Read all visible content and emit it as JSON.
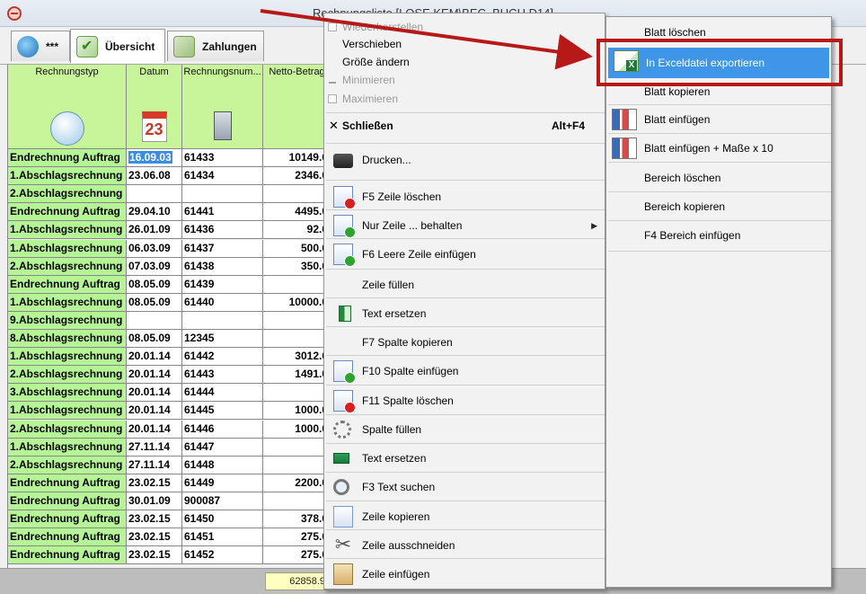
{
  "window": {
    "title": "Rechnungsliste [LOSE KEM\\BEC_BUCH D14]"
  },
  "tabs": [
    {
      "label": "***",
      "icon": "globe-icon"
    },
    {
      "label": "Übersicht",
      "icon": "checklist-icon"
    },
    {
      "label": "Zahlungen",
      "icon": "money-icon"
    }
  ],
  "grid": {
    "headers": [
      "Rechnungstyp",
      "Datum",
      "Rechnungsnum...",
      "Netto-Betrag"
    ],
    "rows": [
      {
        "typ": "Endrechnung Auftrag",
        "datum": "16.09.03",
        "nr": "61433",
        "netto": "10149.0"
      },
      {
        "typ": "1.Abschlagsrechnung",
        "datum": "23.06.08",
        "nr": "61434",
        "netto": "2346.0"
      },
      {
        "typ": "2.Abschlagsrechnung",
        "datum": "",
        "nr": "",
        "netto": ""
      },
      {
        "typ": "Endrechnung Auftrag",
        "datum": "29.04.10",
        "nr": "61441",
        "netto": "4495.0"
      },
      {
        "typ": "1.Abschlagsrechnung",
        "datum": "26.01.09",
        "nr": "61436",
        "netto": "92.0"
      },
      {
        "typ": "1.Abschlagsrechnung",
        "datum": "06.03.09",
        "nr": "61437",
        "netto": "500.0"
      },
      {
        "typ": "2.Abschlagsrechnung",
        "datum": "07.03.09",
        "nr": "61438",
        "netto": "350.0"
      },
      {
        "typ": "Endrechnung Auftrag",
        "datum": "08.05.09",
        "nr": "61439",
        "netto": ""
      },
      {
        "typ": "1.Abschlagsrechnung",
        "datum": "08.05.09",
        "nr": "61440",
        "netto": "10000.0"
      },
      {
        "typ": "9.Abschlagsrechnung",
        "datum": "",
        "nr": "",
        "netto": ""
      },
      {
        "typ": "8.Abschlagsrechnung",
        "datum": "08.05.09",
        "nr": "12345",
        "netto": ""
      },
      {
        "typ": "1.Abschlagsrechnung",
        "datum": "20.01.14",
        "nr": "61442",
        "netto": "3012.0"
      },
      {
        "typ": "2.Abschlagsrechnung",
        "datum": "20.01.14",
        "nr": "61443",
        "netto": "1491.0"
      },
      {
        "typ": "3.Abschlagsrechnung",
        "datum": "20.01.14",
        "nr": "61444",
        "netto": ""
      },
      {
        "typ": "1.Abschlagsrechnung",
        "datum": "20.01.14",
        "nr": "61445",
        "netto": "1000.0"
      },
      {
        "typ": "2.Abschlagsrechnung",
        "datum": "20.01.14",
        "nr": "61446",
        "netto": "1000.0"
      },
      {
        "typ": "1.Abschlagsrechnung",
        "datum": "27.11.14",
        "nr": "61447",
        "netto": ""
      },
      {
        "typ": "2.Abschlagsrechnung",
        "datum": "27.11.14",
        "nr": "61448",
        "netto": ""
      },
      {
        "typ": "Endrechnung Auftrag",
        "datum": "23.02.15",
        "nr": "61449",
        "netto": "2200.0"
      },
      {
        "typ": "Endrechnung Auftrag",
        "datum": "30.01.09",
        "nr": "900087",
        "netto": ""
      },
      {
        "typ": "Endrechnung Auftrag",
        "datum": "23.02.15",
        "nr": "61450",
        "netto": "378.0"
      },
      {
        "typ": "Endrechnung Auftrag",
        "datum": "23.02.15",
        "nr": "61451",
        "netto": "275.0"
      },
      {
        "typ": "Endrechnung Auftrag",
        "datum": "23.02.15",
        "nr": "61452",
        "netto": "275.0"
      }
    ],
    "sum": "62858.9"
  },
  "context_menu": {
    "items": [
      {
        "label": "Wiederherstellen",
        "disabled": true
      },
      {
        "label": "Verschieben"
      },
      {
        "label": "Größe ändern"
      },
      {
        "label": "Minimieren",
        "disabled": true
      },
      {
        "label": "Maximieren",
        "disabled": true
      },
      {
        "label": "Schließen",
        "shortcut": "Alt+F4"
      },
      {
        "label": "Drucken...",
        "icon": "printer-icon"
      },
      {
        "label": "F5 Zeile löschen",
        "icon": "delete-row-icon"
      },
      {
        "label": "Nur Zeile ... behalten",
        "icon": "keep-row-icon"
      },
      {
        "label": "F6 Leere Zeile einfügen",
        "icon": "insert-row-icon"
      },
      {
        "label": "Zeile füllen"
      },
      {
        "label": "Text ersetzen",
        "icon": "replace-icon"
      },
      {
        "label": "F7 Spalte kopieren"
      },
      {
        "label": "F10 Spalte einfügen",
        "icon": "insert-column-icon"
      },
      {
        "label": "F11 Spalte löschen",
        "icon": "delete-column-icon"
      },
      {
        "label": "Spalte füllen",
        "icon": "gear-icon"
      },
      {
        "label": "Text ersetzen",
        "icon": "replace-icon"
      },
      {
        "label": "F3 Text suchen",
        "icon": "search-icon"
      },
      {
        "label": "Zeile kopieren",
        "icon": "copy-icon"
      },
      {
        "label": "Zeile ausschneiden",
        "icon": "scissors-icon"
      },
      {
        "label": "Zeile einfügen",
        "icon": "paste-icon"
      }
    ]
  },
  "submenu": {
    "items": [
      {
        "label": "Blatt löschen"
      },
      {
        "label": "In Exceldatei exportieren",
        "highlighted": true,
        "icon": "excel-icon"
      },
      {
        "label": "Blatt kopieren"
      },
      {
        "label": "Blatt einfügen",
        "icon": "sheets-icon"
      },
      {
        "label": "Blatt einfügen + Maße x 10",
        "icon": "sheets-icon"
      },
      {
        "label": "Bereich löschen"
      },
      {
        "label": "Bereich kopieren"
      },
      {
        "label": "F4 Bereich einfügen"
      }
    ]
  },
  "colors": {
    "accent": "#3f96e8",
    "annotation": "#b71818",
    "type_column": "#b6f596",
    "header": "#c8f59a"
  }
}
